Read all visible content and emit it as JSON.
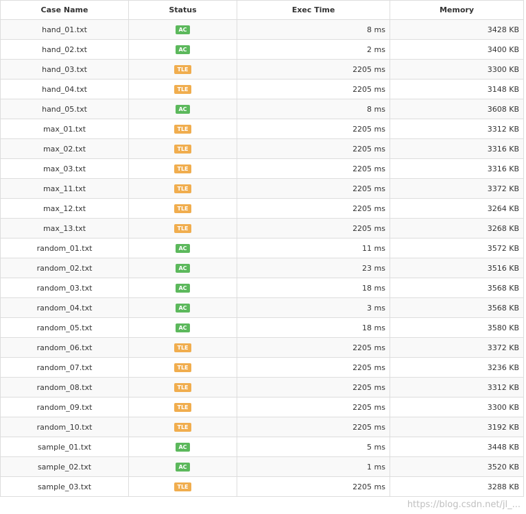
{
  "table": {
    "headers": {
      "case_name": "Case Name",
      "status": "Status",
      "exec_time": "Exec Time",
      "memory": "Memory"
    },
    "rows": [
      {
        "case": "hand_01.txt",
        "status": "AC",
        "time": "8 ms",
        "memory": "3428 KB"
      },
      {
        "case": "hand_02.txt",
        "status": "AC",
        "time": "2 ms",
        "memory": "3400 KB"
      },
      {
        "case": "hand_03.txt",
        "status": "TLE",
        "time": "2205 ms",
        "memory": "3300 KB"
      },
      {
        "case": "hand_04.txt",
        "status": "TLE",
        "time": "2205 ms",
        "memory": "3148 KB"
      },
      {
        "case": "hand_05.txt",
        "status": "AC",
        "time": "8 ms",
        "memory": "3608 KB"
      },
      {
        "case": "max_01.txt",
        "status": "TLE",
        "time": "2205 ms",
        "memory": "3312 KB"
      },
      {
        "case": "max_02.txt",
        "status": "TLE",
        "time": "2205 ms",
        "memory": "3316 KB"
      },
      {
        "case": "max_03.txt",
        "status": "TLE",
        "time": "2205 ms",
        "memory": "3316 KB"
      },
      {
        "case": "max_11.txt",
        "status": "TLE",
        "time": "2205 ms",
        "memory": "3372 KB"
      },
      {
        "case": "max_12.txt",
        "status": "TLE",
        "time": "2205 ms",
        "memory": "3264 KB"
      },
      {
        "case": "max_13.txt",
        "status": "TLE",
        "time": "2205 ms",
        "memory": "3268 KB"
      },
      {
        "case": "random_01.txt",
        "status": "AC",
        "time": "11 ms",
        "memory": "3572 KB"
      },
      {
        "case": "random_02.txt",
        "status": "AC",
        "time": "23 ms",
        "memory": "3516 KB"
      },
      {
        "case": "random_03.txt",
        "status": "AC",
        "time": "18 ms",
        "memory": "3568 KB"
      },
      {
        "case": "random_04.txt",
        "status": "AC",
        "time": "3 ms",
        "memory": "3568 KB"
      },
      {
        "case": "random_05.txt",
        "status": "AC",
        "time": "18 ms",
        "memory": "3580 KB"
      },
      {
        "case": "random_06.txt",
        "status": "TLE",
        "time": "2205 ms",
        "memory": "3372 KB"
      },
      {
        "case": "random_07.txt",
        "status": "TLE",
        "time": "2205 ms",
        "memory": "3236 KB"
      },
      {
        "case": "random_08.txt",
        "status": "TLE",
        "time": "2205 ms",
        "memory": "3312 KB"
      },
      {
        "case": "random_09.txt",
        "status": "TLE",
        "time": "2205 ms",
        "memory": "3300 KB"
      },
      {
        "case": "random_10.txt",
        "status": "TLE",
        "time": "2205 ms",
        "memory": "3192 KB"
      },
      {
        "case": "sample_01.txt",
        "status": "AC",
        "time": "5 ms",
        "memory": "3448 KB"
      },
      {
        "case": "sample_02.txt",
        "status": "AC",
        "time": "1 ms",
        "memory": "3520 KB"
      },
      {
        "case": "sample_03.txt",
        "status": "TLE",
        "time": "2205 ms",
        "memory": "3288 KB"
      }
    ]
  },
  "status_colors": {
    "AC": "#5cb85c",
    "TLE": "#f0ad4e"
  },
  "watermark": "https://blog.csdn.net/jl_..."
}
